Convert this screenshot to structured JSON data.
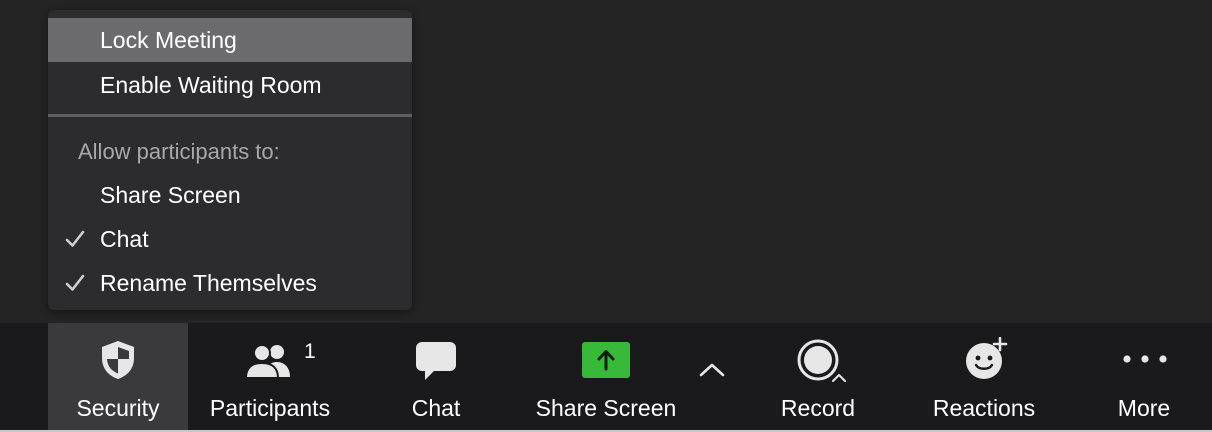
{
  "menu": {
    "items": [
      {
        "label": "Lock Meeting",
        "checked": false,
        "highlighted": true
      },
      {
        "label": "Enable Waiting Room",
        "checked": false,
        "highlighted": false
      }
    ],
    "section_label": "Allow participants to:",
    "permissions": [
      {
        "label": "Share Screen",
        "checked": false
      },
      {
        "label": "Chat",
        "checked": true
      },
      {
        "label": "Rename Themselves",
        "checked": true
      }
    ]
  },
  "toolbar": {
    "security": {
      "label": "Security",
      "icon": "shield-icon"
    },
    "participants": {
      "label": "Participants",
      "count": "1",
      "icon": "participants-icon"
    },
    "chat": {
      "label": "Chat",
      "icon": "chat-bubble-icon"
    },
    "share_screen": {
      "label": "Share Screen",
      "icon": "share-screen-arrow-icon"
    },
    "record": {
      "label": "Record",
      "icon": "record-icon"
    },
    "reactions": {
      "label": "Reactions",
      "icon": "emoji-add-icon"
    },
    "more": {
      "label": "More",
      "icon": "more-dots-icon"
    }
  },
  "colors": {
    "share_green": "#38b93a",
    "background": "#242424",
    "toolbar": "#1a1a1c",
    "menu": "#2c2c2e",
    "highlight": "#6b6b6d"
  }
}
